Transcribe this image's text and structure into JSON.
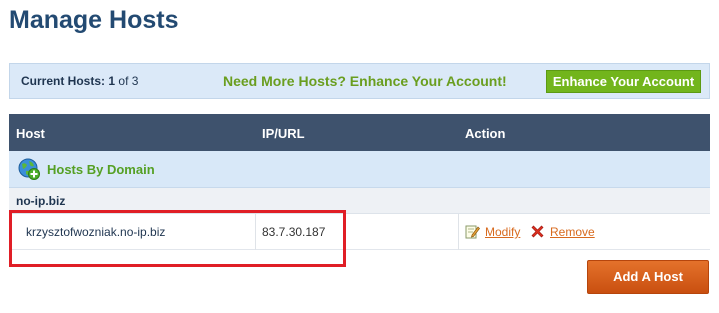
{
  "page": {
    "title": "Manage Hosts"
  },
  "info_bar": {
    "current_label": "Current Hosts:",
    "current_count": "1",
    "of_text": "of 3",
    "promo_text": "Need More Hosts? Enhance Your Account!",
    "enhance_button": "Enhance Your Account"
  },
  "table": {
    "headers": {
      "host": "Host",
      "ip": "IP/URL",
      "action": "Action"
    },
    "group_label": "Hosts By Domain",
    "domain": "no-ip.biz",
    "rows": [
      {
        "host": "krzysztofwozniak.no-ip.biz",
        "ip": "83.7.30.187",
        "modify": "Modify",
        "remove": "Remove"
      }
    ]
  },
  "add_button": "Add A Host",
  "icons": {
    "globe": "globe-add-icon",
    "modify": "edit-pencil-icon",
    "remove": "red-x-icon"
  },
  "colors": {
    "title": "#234a72",
    "header_bg": "#3e526d",
    "accent_green": "#72b51c",
    "link_orange": "#d86a1e",
    "highlight_red": "#e01e26"
  }
}
